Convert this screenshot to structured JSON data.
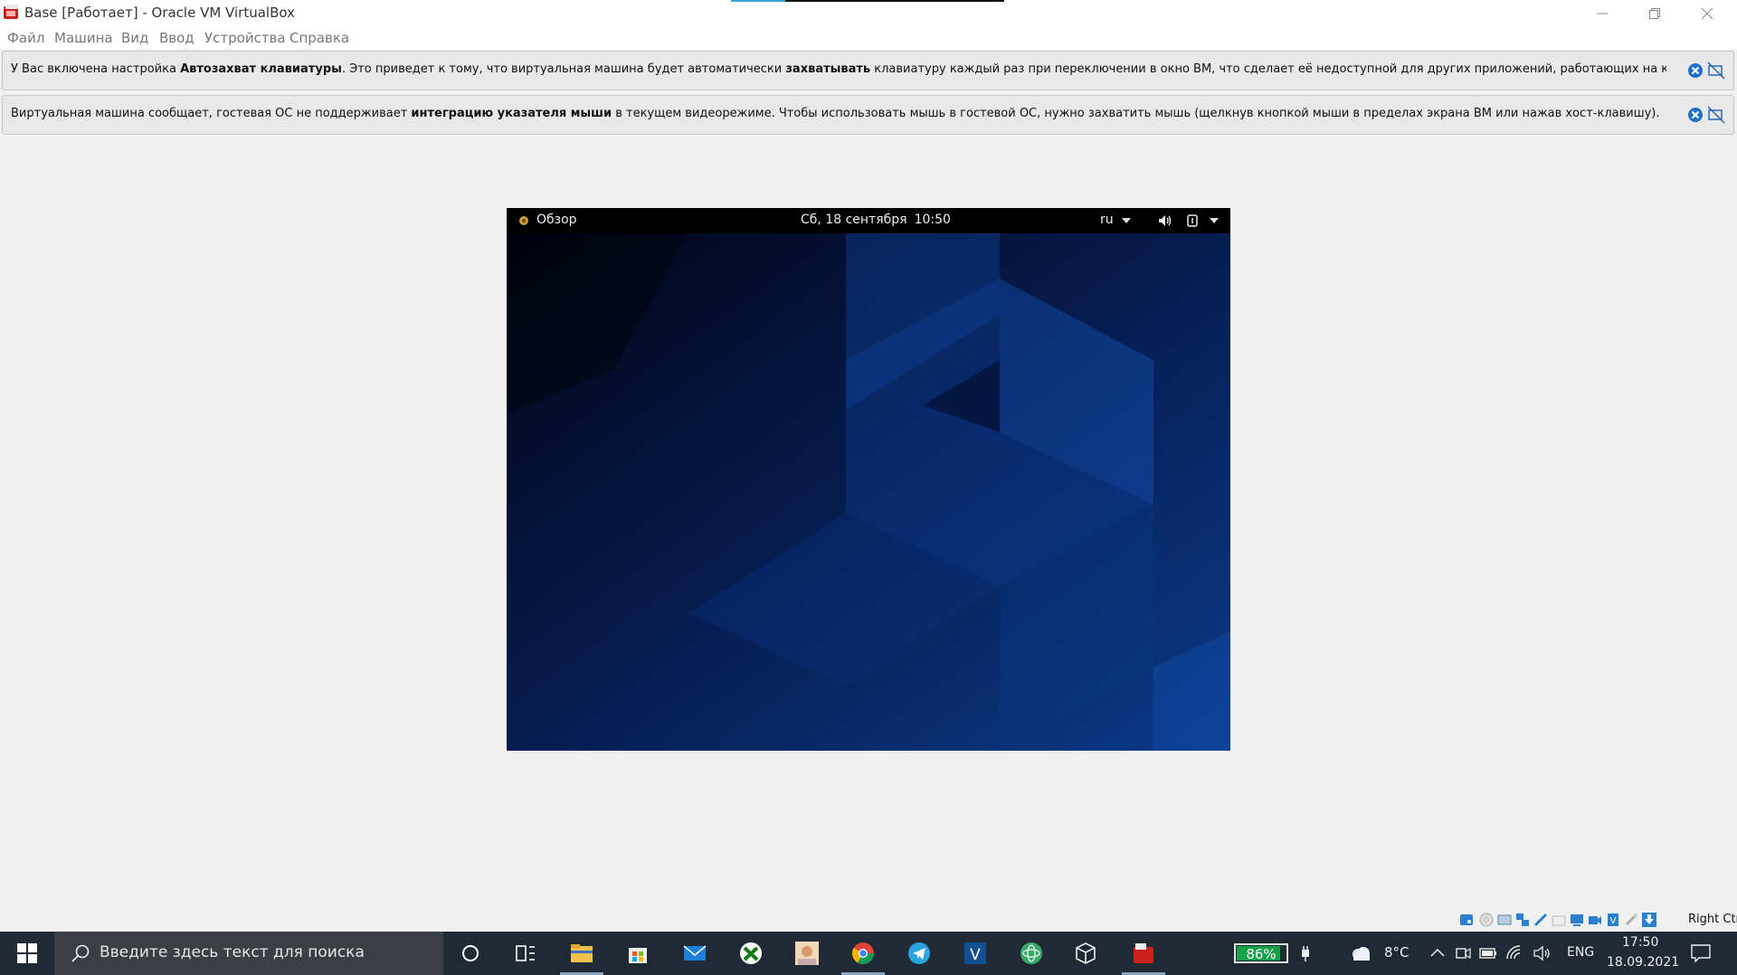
{
  "window": {
    "title": "Base [Работает] - Oracle VM VirtualBox",
    "progress_fraction": 0.2
  },
  "menu": [
    "Файл",
    "Машина",
    "Вид",
    "Ввод",
    "Устройства",
    "Справка"
  ],
  "notices": [
    {
      "parts": [
        {
          "text": "У Вас включена настройка ",
          "bold": false
        },
        {
          "text": "Автозахват клавиатуры",
          "bold": true
        },
        {
          "text": ". Это приведет к тому, что виртуальная машина будет автоматически ",
          "bold": false
        },
        {
          "text": "захватывать",
          "bold": true
        },
        {
          "text": " клавиатуру каждый раз при переключении в окно ВМ, что сделает её недоступной для других приложений, работающих на компьютере: когда клавиатура захвачена,",
          "bold": false
        }
      ]
    },
    {
      "parts": [
        {
          "text": "Виртуальная машина сообщает, гостевая ОС не поддерживает ",
          "bold": false
        },
        {
          "text": "интеграцию указателя мыши",
          "bold": true
        },
        {
          "text": " в текущем видеорежиме. Чтобы использовать мышь в гостевой ОС, нужно захватить мышь (щелкнув кнопкой мыши в пределах экрана ВМ или нажав хост-клавишу).",
          "bold": false
        }
      ]
    }
  ],
  "vm": {
    "activities": "Обзор",
    "date": "Сб, 18 сентября",
    "time": "10:50",
    "lang": "ru"
  },
  "statusbar": {
    "host_key": "Right Ctrl"
  },
  "taskbar": {
    "search_placeholder": "Введите здесь текст для поиска",
    "battery_percent": "86%",
    "battery_fraction": 0.86,
    "temperature": "8°C",
    "keyboard_lang": "ENG",
    "clock_time": "17:50",
    "clock_date": "18.09.2021"
  },
  "colors": {
    "accent": "#3aa3d8",
    "battery_green": "#19a04a",
    "taskbar_bg": "#202a35",
    "vm_bg": "#0a2a6c"
  }
}
